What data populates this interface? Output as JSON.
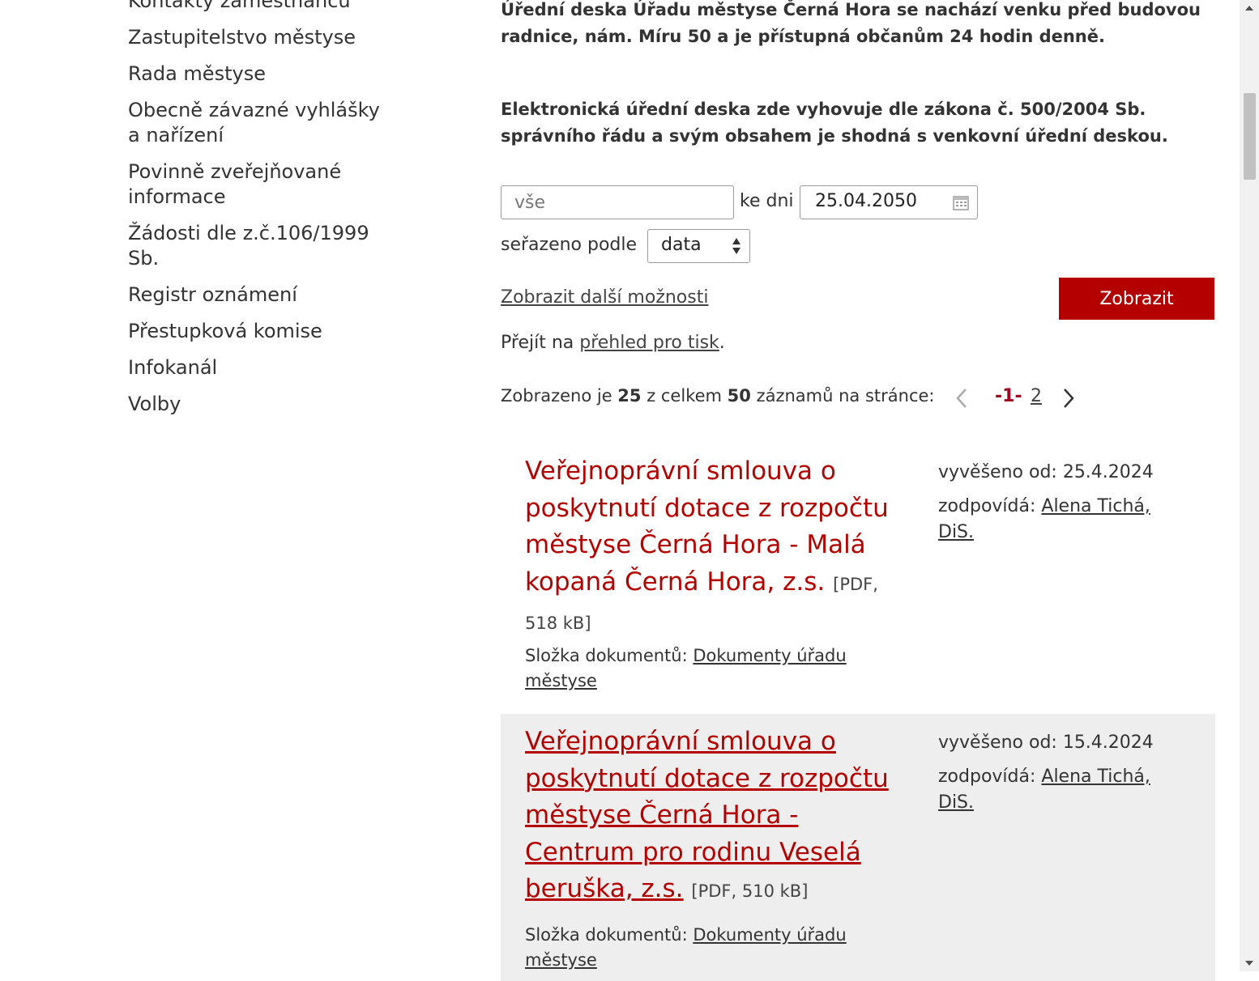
{
  "sidebar": {
    "items": [
      "Kontakty zaměstnanců",
      "Zastupitelstvo městyse",
      "Rada městyse",
      "Obecně závazné vyhlášky a nařízení",
      "Povinně zveřejňované informace",
      "Žádosti dle z.č.106/1999 Sb.",
      "Registr oznámení",
      "Přestupková komise",
      "Infokanál",
      "Volby"
    ]
  },
  "notice": {
    "text1": "Úřední deska Úřadu městyse Černá Hora se nachází venku před budovou radnice, nám. Míru 50 a je přístupná občanům 24 hodin denně.",
    "text2": "Elektronická úřední deska zde vyhovuje dle zákona č. 500/2004 Sb. správního řádu a svým obsahem je shodná s venkovní úřední deskou."
  },
  "filter": {
    "search_placeholder": "vše",
    "date_label": "ke dni",
    "date_value": "25.04.2050",
    "sort_label": "seřazeno podle",
    "sort_value": "data",
    "more_options": "Zobrazit další možnosti",
    "submit": "Zobrazit"
  },
  "print": {
    "prefix": "Přejít na ",
    "link": "přehled pro tisk",
    "suffix": "."
  },
  "pagination": {
    "text_a": "Zobrazeno je ",
    "shown": "25",
    "text_b": " z celkem ",
    "total": "50",
    "text_c": " záznamů na stránce:",
    "current": "-1-",
    "page2": "2"
  },
  "records": [
    {
      "title": "Veřejnoprávní smlouva o poskytnutí dotace z rozpočtu městyse Černá Hora - Malá kopaná Černá Hora, z.s.",
      "file_meta": "[PDF, 518 kB]",
      "folder_label": "Složka dokumentů: ",
      "folder_link": "Dokumenty úřadu městyse",
      "posted": "vyvěšeno od: 25.4.2024",
      "resp_label": "zodpovídá: ",
      "resp_name": "Alena Tichá, DiS."
    },
    {
      "title": "Veřejnoprávní smlouva o poskytnutí dotace z rozpočtu městyse Černá Hora - Centrum pro rodinu Veselá beruška, z.s.",
      "file_meta": "[PDF, 510 kB]",
      "folder_label": "Složka dokumentů: ",
      "folder_link": "Dokumenty úřadu městyse",
      "posted": "vyvěšeno od: 15.4.2024",
      "resp_label": "zodpovídá: ",
      "resp_name": "Alena Tichá, DiS."
    }
  ],
  "colors": {
    "accent": "#b50000",
    "record_alt_bg": "#eeeeee"
  }
}
